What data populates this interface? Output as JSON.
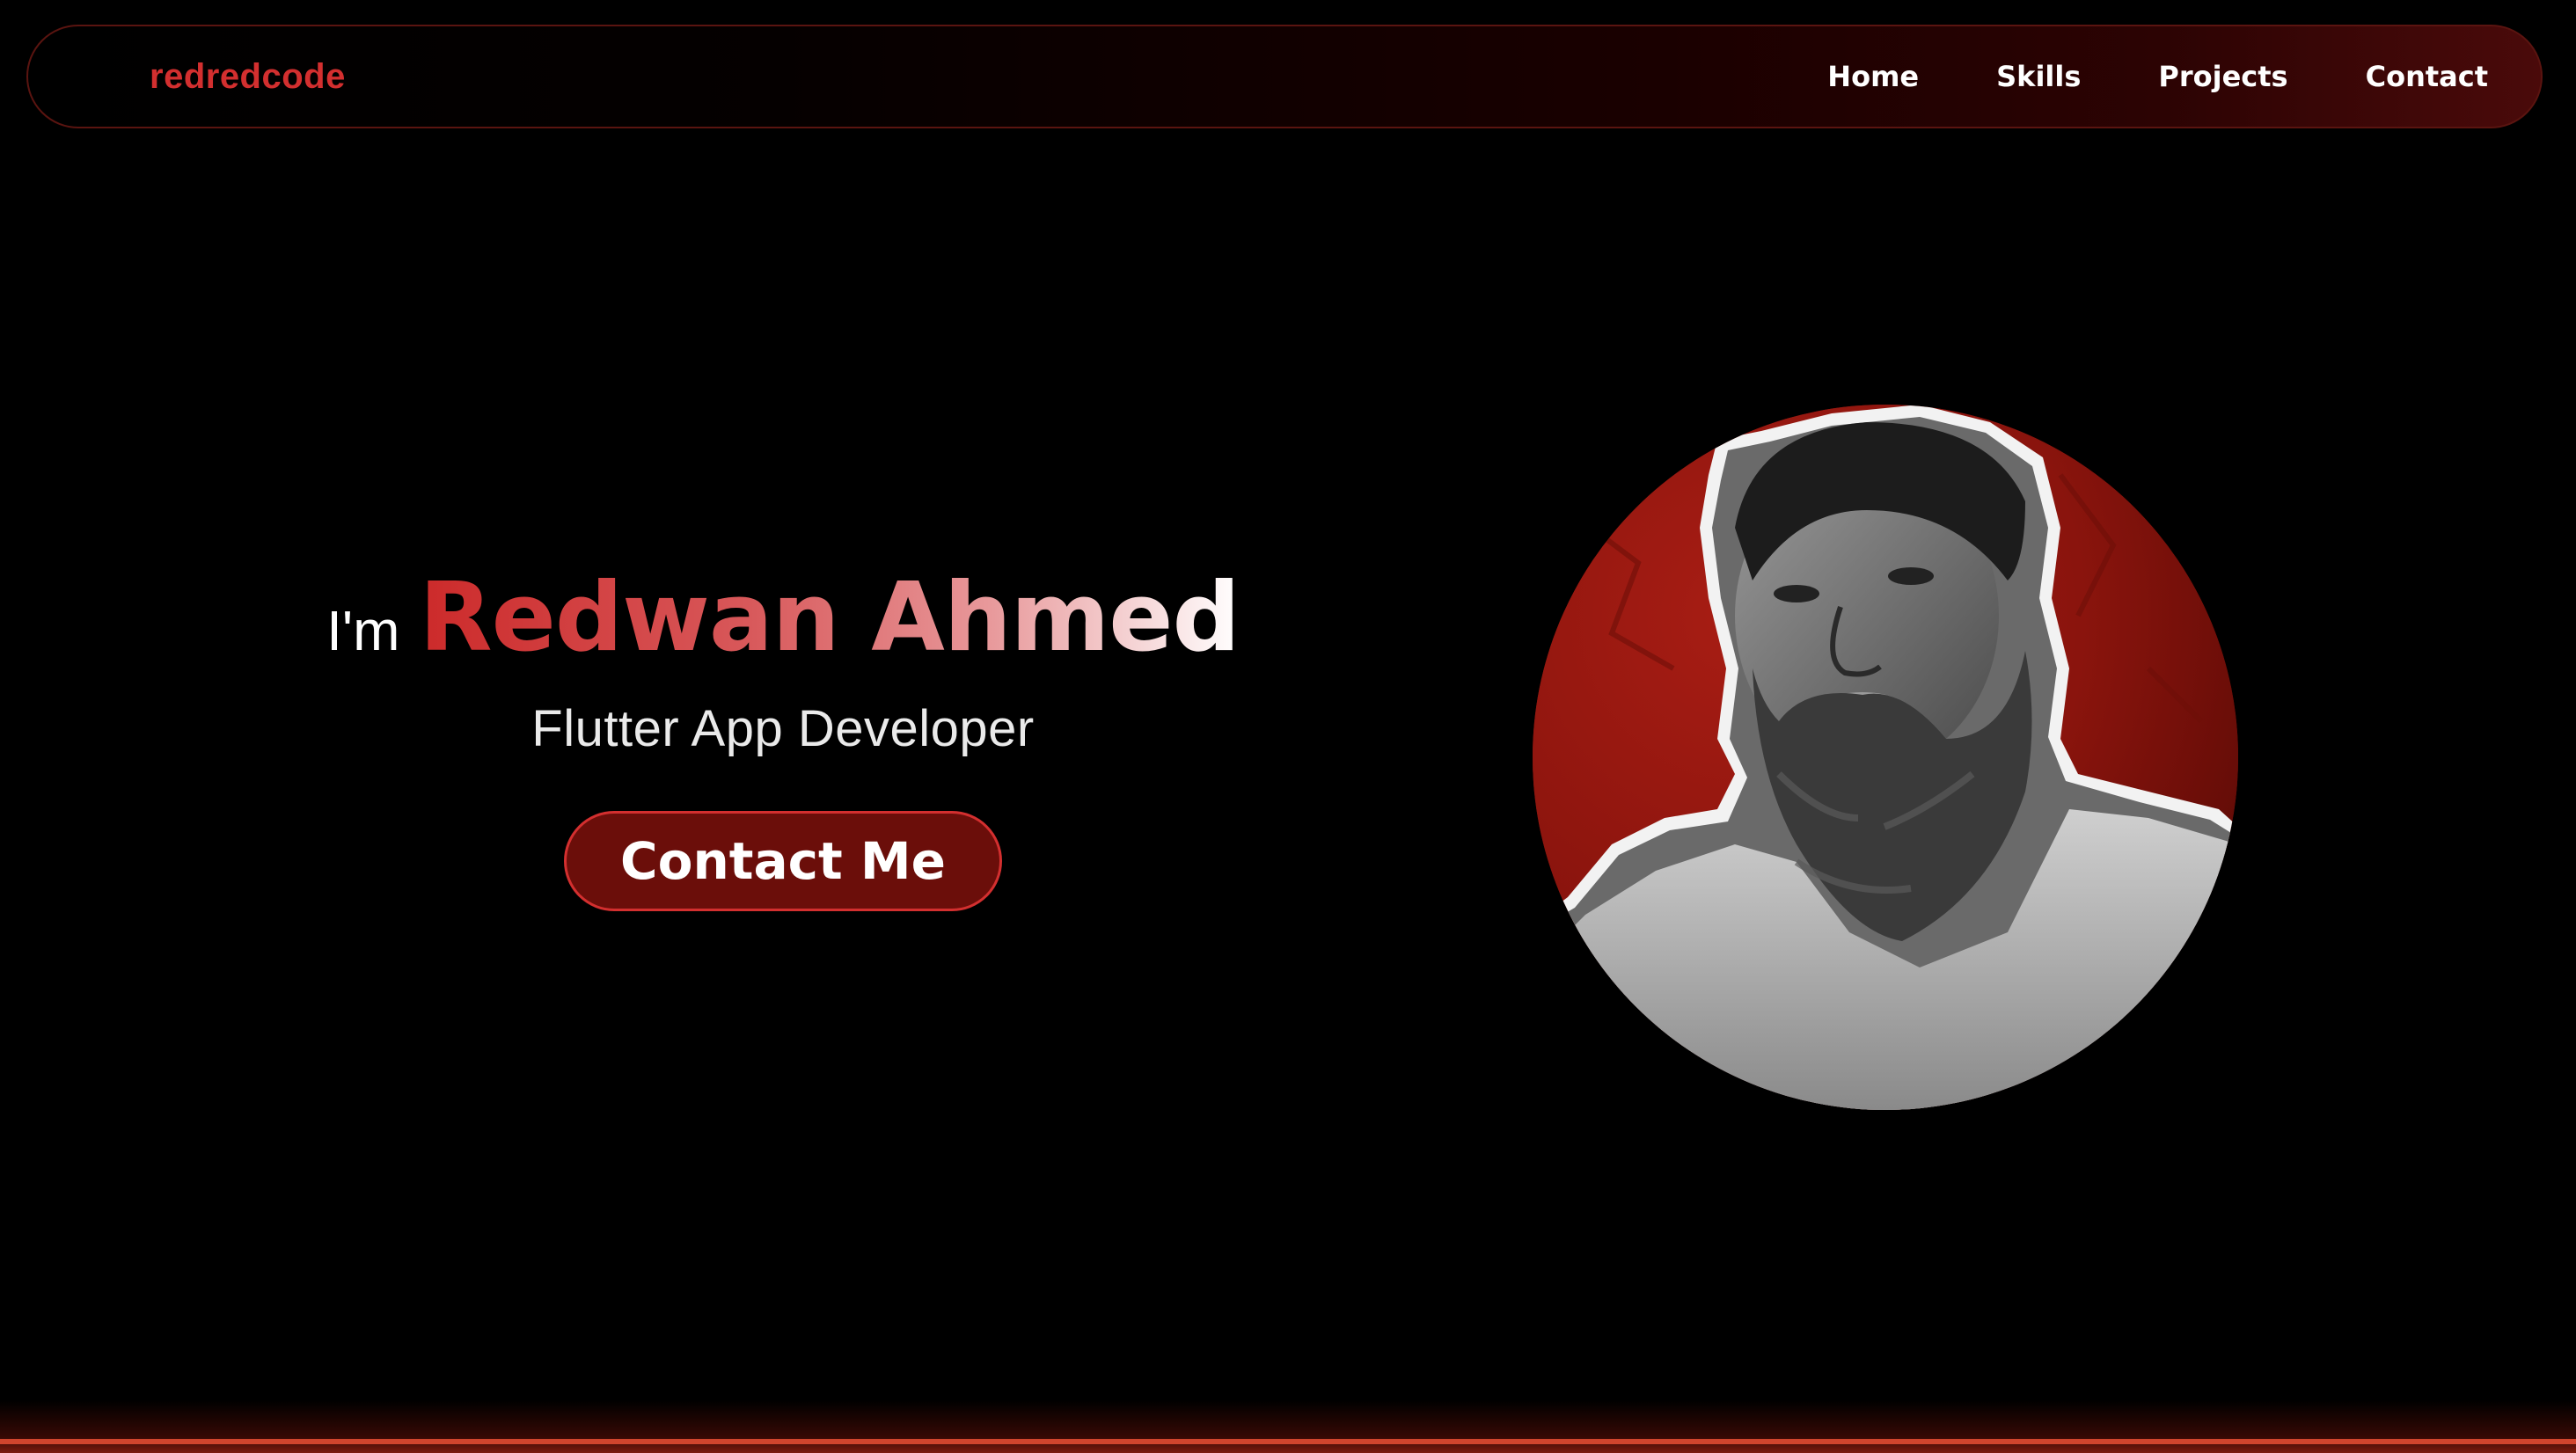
{
  "navbar": {
    "logo": "redredcode",
    "links": [
      "Home",
      "Skills",
      "Projects",
      "Contact"
    ]
  },
  "hero": {
    "greeting_prefix": "I'm",
    "name": "Redwan Ahmed",
    "subtitle": "Flutter App Developer",
    "cta_label": "Contact Me"
  },
  "colors": {
    "background": "#000000",
    "accent": "#d32f2f",
    "button_fill": "#6b0e0a",
    "avatar_bg": "#8b150e"
  },
  "avatar": {
    "icon": "profile-photo"
  }
}
